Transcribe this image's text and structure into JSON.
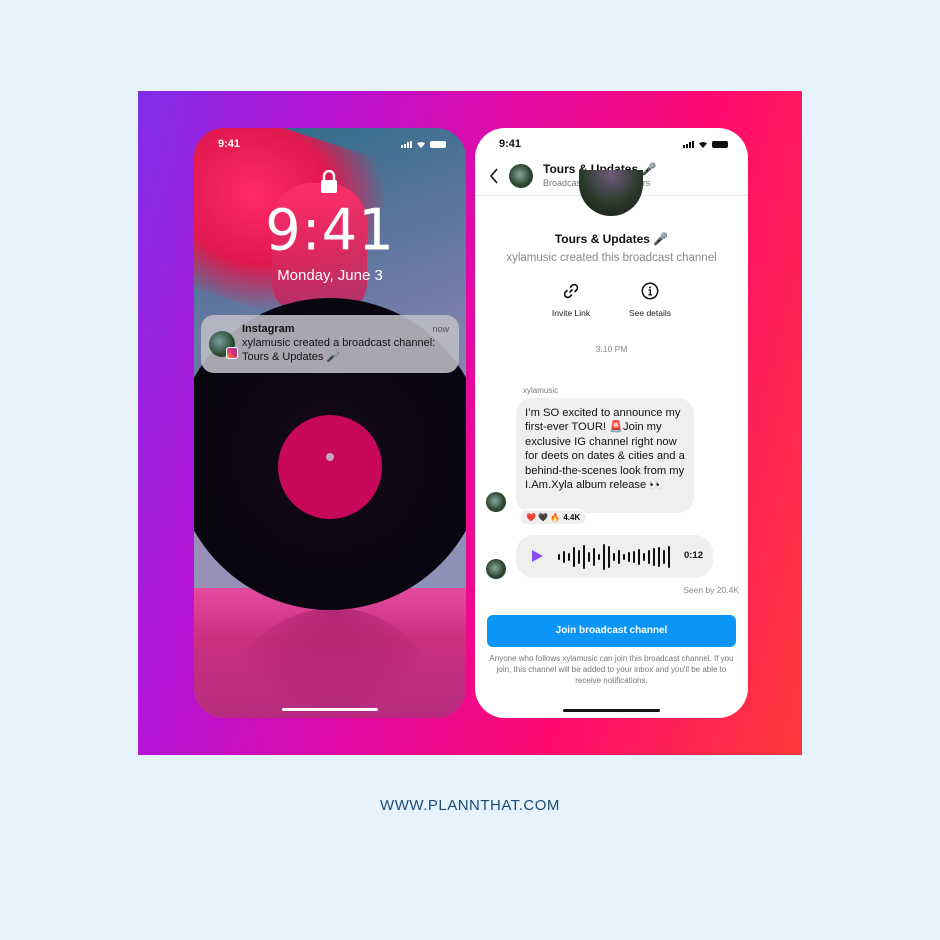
{
  "footer": {
    "url": "WWW.PLANNTHAT.COM"
  },
  "colors": {
    "background": "#e6f2fc",
    "gradient_start": "#7f2ee8",
    "gradient_end": "#ff3a3a",
    "join_button": "#0b95f6",
    "play_icon": "#8a4cf5",
    "footer_text": "#1c4a75"
  },
  "lock_screen": {
    "status_time": "9:41",
    "lock_icon": "lock-icon",
    "clock": "9:41",
    "date": "Monday, June 3",
    "notification": {
      "app": "Instagram",
      "time": "now",
      "body": "xylamusic created a broadcast channel: Tours & Updates 🎤",
      "badge_icon": "instagram-icon"
    }
  },
  "channel_screen": {
    "status_time": "9:41",
    "header": {
      "back_icon": "chevron-left-icon",
      "title": "Tours & Updates 🎤",
      "subtitle": "Broadcast • 6.5K members"
    },
    "channel_name": "Tours & Updates 🎤",
    "created_text": "xylamusic created this broadcast channel",
    "actions": [
      {
        "icon": "link-icon",
        "label": "Invite Link"
      },
      {
        "icon": "info-icon",
        "label": "See details"
      }
    ],
    "timestamp": "3:10 PM",
    "message": {
      "sender": "xylamusic",
      "text": "I’m SO excited to announce my first-ever TOUR! 🚨Join my exclusive IG channel right now for deets on dates & cities and a behind-the-scenes look from my I.Am.Xyla album release 👀",
      "reactions": "❤️ 🖤 🔥",
      "reaction_count": "4.4K"
    },
    "voice_message": {
      "play_icon": "play-icon",
      "duration": "0:12"
    },
    "seen_text": "Seen by 20.4K",
    "join_button": "Join broadcast channel",
    "join_note": "Anyone who follows xylamusic can join this broadcast channel. If you join, this channel will be added to your inbox and you'll be able to receive notifications."
  }
}
